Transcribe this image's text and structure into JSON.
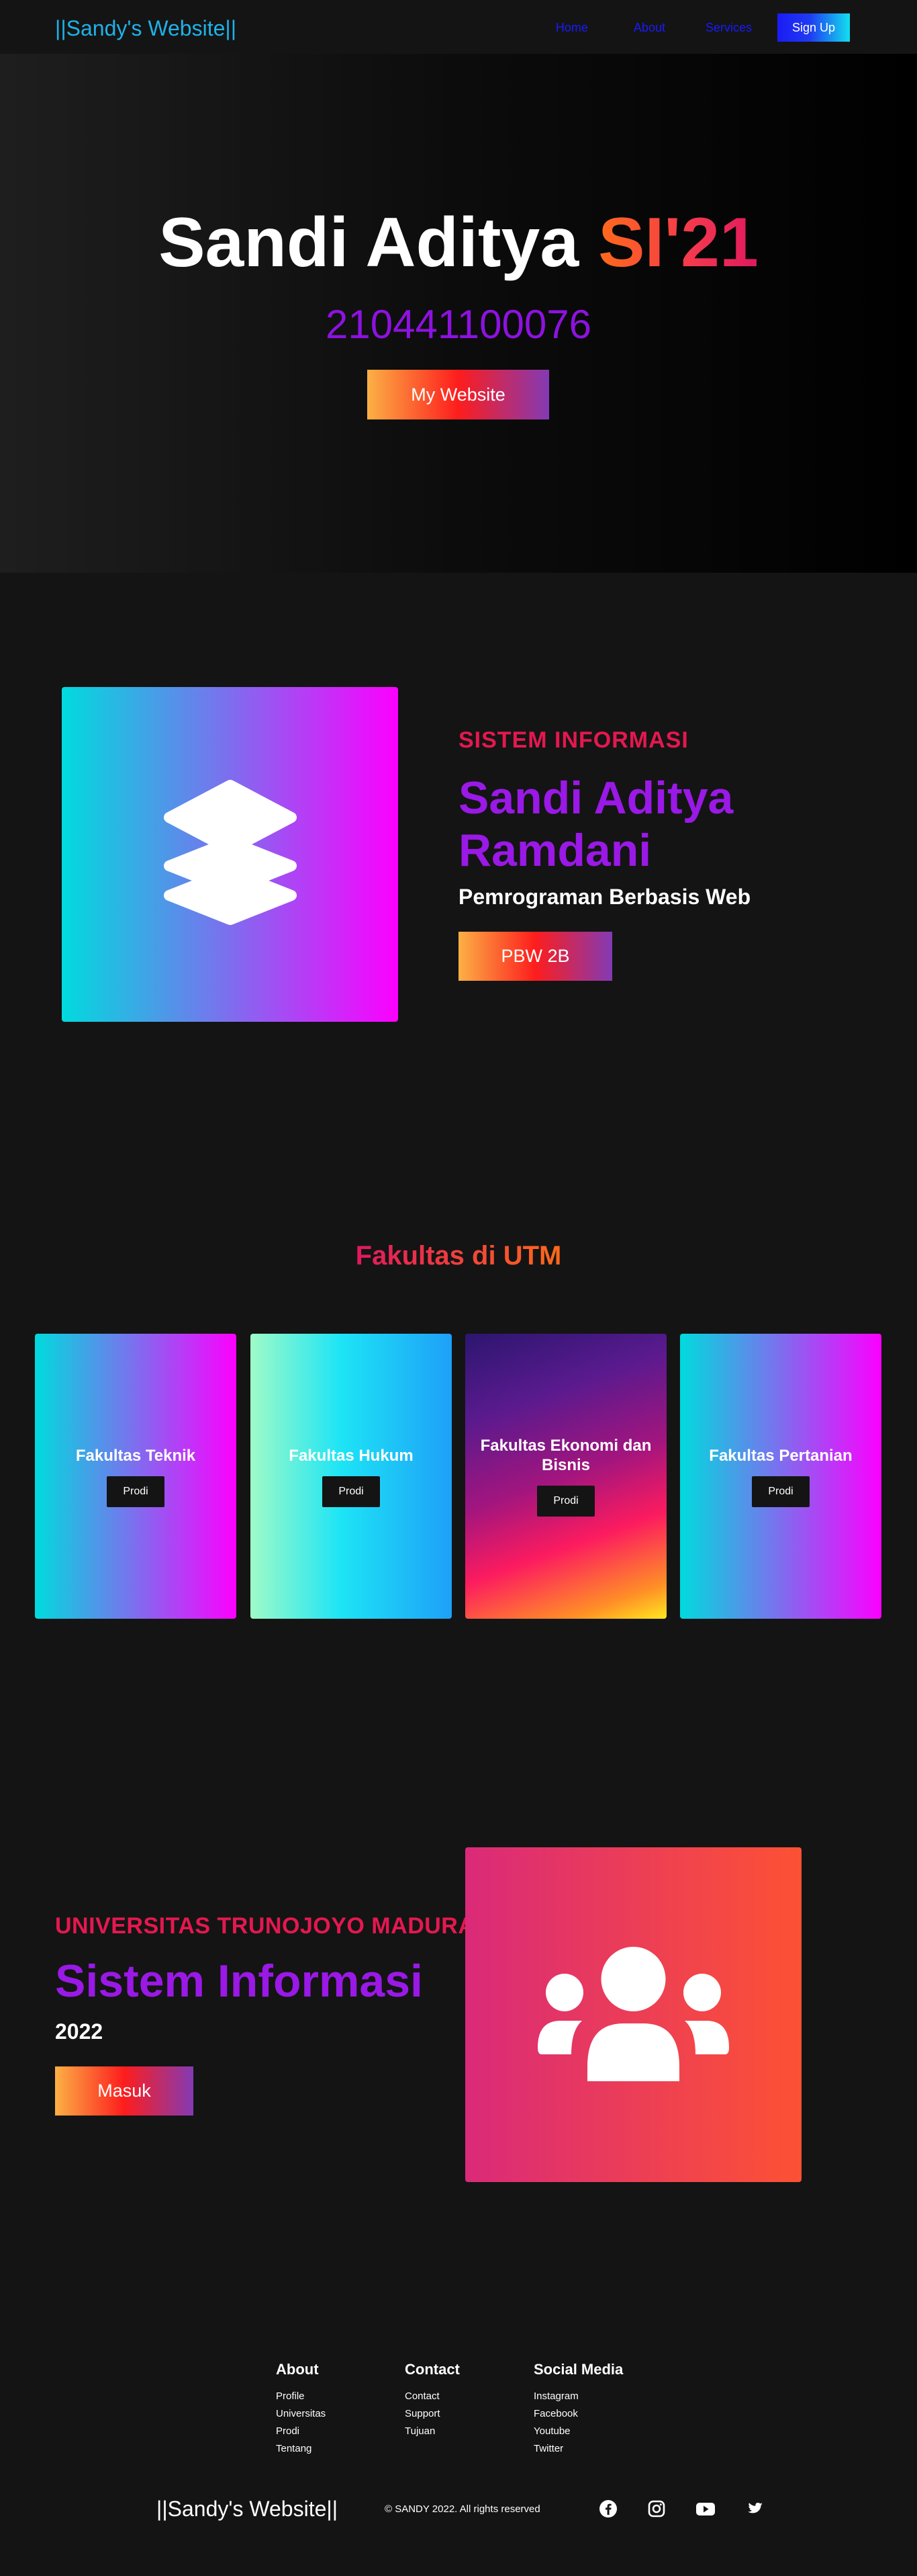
{
  "nav": {
    "logo": "||Sandy's Website||",
    "links": [
      "Home",
      "About",
      "Services"
    ],
    "signup": "Sign Up"
  },
  "hero": {
    "title_main": "Sandi Aditya ",
    "title_accent": "SI'21",
    "nim": "210441100076",
    "button": "My Website"
  },
  "about": {
    "category": "SISTEM INFORMASI",
    "name": "Sandi Aditya Ramdani",
    "subtitle": "Pemrograman Berbasis Web",
    "button": "PBW 2B",
    "icon": "layers-icon"
  },
  "faculties": {
    "title": "Fakultas di UTM",
    "cards": [
      {
        "title": "Fakultas Teknik",
        "button": "Prodi"
      },
      {
        "title": "Fakultas Hukum",
        "button": "Prodi"
      },
      {
        "title": "Fakultas Ekonomi dan Bisnis",
        "button": "Prodi"
      },
      {
        "title": "Fakultas Pertanian",
        "button": "Prodi"
      }
    ]
  },
  "utm": {
    "category": "UNIVERSITAS TRUNOJOYO MADURA",
    "name": "Sistem Informasi",
    "year": "2022",
    "button": "Masuk",
    "icon": "users-icon"
  },
  "footer": {
    "columns": [
      {
        "heading": "About",
        "items": [
          "Profile",
          "Universitas",
          "Prodi",
          "Tentang"
        ]
      },
      {
        "heading": "Contact",
        "items": [
          "Contact",
          "Support",
          "Tujuan"
        ]
      },
      {
        "heading": "Social Media",
        "items": [
          "Instagram",
          "Facebook",
          "Youtube",
          "Twitter"
        ]
      }
    ],
    "logo": "||Sandy's Website||",
    "copyright": "© SANDY 2022. All rights reserved",
    "social_icons": [
      "facebook-icon",
      "instagram-icon",
      "youtube-icon",
      "twitter-icon"
    ]
  },
  "colors": {
    "background": "#141414",
    "logo_blue": "#1eb2e8",
    "nav_link": "#1a1aff",
    "accent_pink": "#e4184f",
    "accent_purple": "#9a19e6"
  }
}
